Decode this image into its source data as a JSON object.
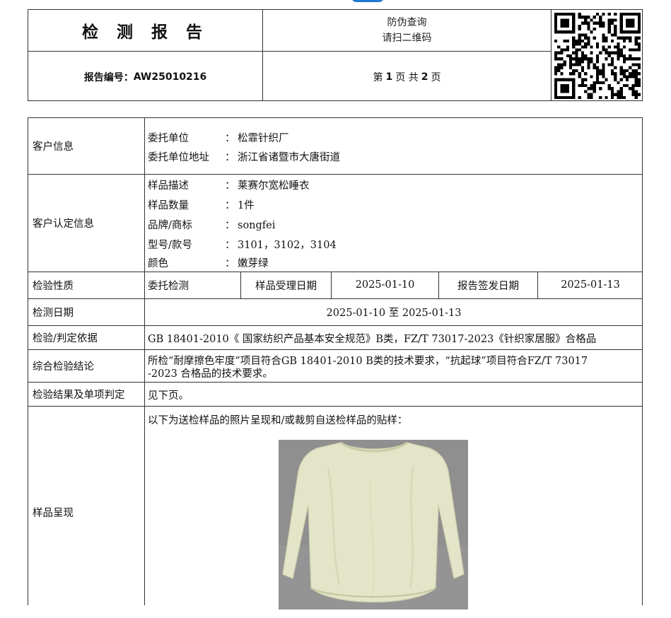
{
  "header": {
    "title": "检 测 报 告",
    "anti_fake_line1": "防伪查询",
    "anti_fake_line2": "请扫二维码",
    "report_no_label": "报告编号：",
    "report_no": "AW25010216",
    "page_prefix": "第",
    "page_current": "1",
    "page_mid": "页 共",
    "page_total": "2",
    "page_suffix": "页",
    "qr_icon": "qr-code-icon"
  },
  "customer_info": {
    "label": "客户信息",
    "client_key": "委托单位",
    "client_value": "松霏针织厂",
    "address_key": "委托单位地址",
    "address_value": "浙江省诸暨市大唐街道"
  },
  "customer_confirmed": {
    "label": "客户认定信息",
    "colon": "：",
    "items": [
      {
        "key": "样品描述",
        "value": "莱赛尔宽松睡衣"
      },
      {
        "key": "样品数量",
        "value": "1件"
      },
      {
        "key": "品牌/商标",
        "value": "songfei"
      },
      {
        "key": "型号/款号",
        "value": "3101，3102，3104"
      },
      {
        "key": "颜色",
        "value": "嫩芽绿"
      }
    ]
  },
  "inspection_nature": {
    "label": "检验性质",
    "value": "委托检测",
    "received_label": "样品受理日期",
    "received_date": "2025-01-10",
    "issued_label": "报告签发日期",
    "issued_date": "2025-01-13"
  },
  "test_date": {
    "label": "检测日期",
    "value": "2025-01-10 至 2025-01-13"
  },
  "basis": {
    "label": "检验/判定依据",
    "value": "GB 18401-2010《 国家纺织产品基本安全规范》B类，FZ/T 73017-2023《针织家居服》合格品"
  },
  "conclusion": {
    "label": "综合检验结论",
    "line1": "所检“耐摩擦色牢度”项目符合GB 18401-2010 B类的技术要求，“抗起球”项目符合FZ/T 73017",
    "line2": "-2023 合格品的技术要求。"
  },
  "results": {
    "label": "检验结果及单项判定",
    "value": "见下页。"
  },
  "sample": {
    "label": "样品呈现",
    "caption": "以下为送检样品的照片呈现和/或裁剪自送检样品的贴样：",
    "photo_fill": "#e3e4c8",
    "photo_bg": "#8e8e8e"
  }
}
